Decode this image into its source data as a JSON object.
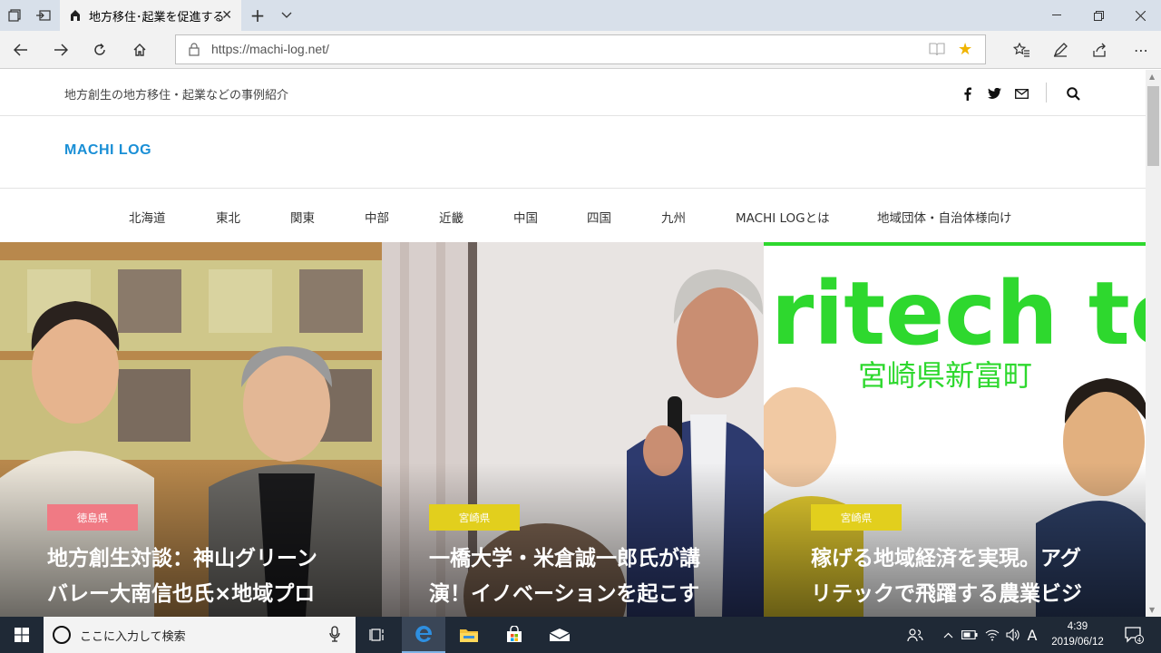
{
  "browser": {
    "tab_title": "地方移住･起業を促進するメディア",
    "url": "https://machi-log.net/"
  },
  "site": {
    "tagline": "地方創生の地方移住・起業などの事例紹介",
    "logo": "MACHI LOG",
    "nav": [
      "北海道",
      "東北",
      "関東",
      "中部",
      "近畿",
      "中国",
      "四国",
      "九州",
      "MACHI LOGとは",
      "地域団体・自治体様向け"
    ],
    "cards": [
      {
        "badge": "徳島県",
        "badge_color": "#f07a84",
        "title_line1": "地方創生対談：神山グリーン",
        "title_line2": "バレー大南信也氏×地域プロ"
      },
      {
        "badge": "宮崎県",
        "badge_color": "#e2cf1d",
        "title_line1": "一橋大学・米倉誠一郎氏が講",
        "title_line2": "演！イノベーションを起こす"
      },
      {
        "badge": "宮崎県",
        "badge_color": "#e2cf1d",
        "title_line1": "稼げる地域経済を実現。アグ",
        "title_line2": "リテックで飛躍する農業ビジ",
        "image_text_1": "ritech to",
        "image_text_2": "宮崎県新富町"
      }
    ]
  },
  "taskbar": {
    "search_placeholder": "ここに入力して検索",
    "time": "4:39",
    "date": "2019/06/12",
    "ime": "A",
    "notification_count": "4"
  }
}
